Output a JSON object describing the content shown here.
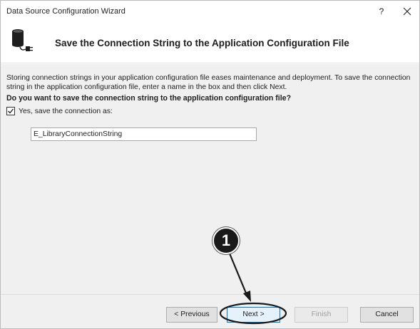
{
  "window": {
    "title": "Data Source Configuration Wizard",
    "help_label": "?"
  },
  "header": {
    "title": "Save the Connection String to the Application Configuration File",
    "icon": "database-plug-icon"
  },
  "content": {
    "intro": "Storing connection strings in your application configuration file eases maintenance and deployment. To save the connection string in the application configuration file, enter a name in the box and then click Next.",
    "question": "Do you want to save the connection string to the application configuration file?",
    "save_checkbox": {
      "label": "Yes, save the connection as:",
      "checked": true
    },
    "connection_name_value": "E_LibraryConnectionString"
  },
  "footer": {
    "previous_label": "< Previous",
    "next_label": "Next >",
    "finish_label": "Finish",
    "cancel_label": "Cancel"
  },
  "annotation": {
    "step_number": "1"
  },
  "colors": {
    "body_bg": "#f0f0f0",
    "focus_blue": "#0078d7",
    "annotation_black": "#1a1a1a"
  }
}
